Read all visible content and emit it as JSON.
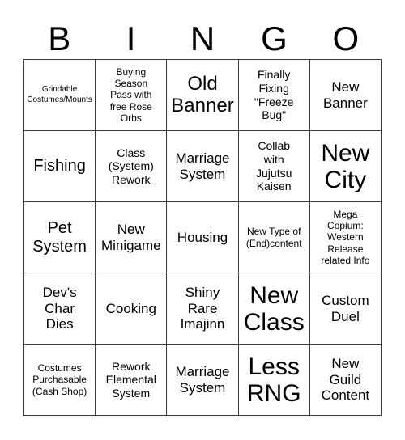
{
  "card": {
    "header_letters": [
      "B",
      "I",
      "N",
      "G",
      "O"
    ],
    "colors": {
      "background": "#ffffff",
      "text": "#000000",
      "grid_line": "#3a3a3a"
    },
    "rows": [
      [
        {
          "text": "Grindable\nCostumes/Mounts",
          "size": "xxs"
        },
        {
          "text": "Buying\nSeason\nPass with\nfree Rose\nOrbs",
          "size": "xs"
        },
        {
          "text": "Old\nBanner",
          "size": "xl"
        },
        {
          "text": "Finally\nFixing\n\"Freeze\nBug\"",
          "size": "s"
        },
        {
          "text": "New\nBanner",
          "size": "m"
        }
      ],
      [
        {
          "text": "Fishing",
          "size": "l"
        },
        {
          "text": "Class\n(System)\nRework",
          "size": "s"
        },
        {
          "text": "Marriage\nSystem",
          "size": "m"
        },
        {
          "text": "Collab\nwith\nJujutsu\nKaisen",
          "size": "s"
        },
        {
          "text": "New\nCity",
          "size": "xxl"
        }
      ],
      [
        {
          "text": "Pet\nSystem",
          "size": "l"
        },
        {
          "text": "New\nMinigame",
          "size": "m"
        },
        {
          "text": "Housing",
          "size": "m"
        },
        {
          "text": "New Type of\n(End)content",
          "size": "xs"
        },
        {
          "text": "Mega\nCopium:\nWestern\nRelease\nrelated Info",
          "size": "xs"
        }
      ],
      [
        {
          "text": "Dev's\nChar\nDies",
          "size": "m"
        },
        {
          "text": "Cooking",
          "size": "m"
        },
        {
          "text": "Shiny\nRare\nImajinn",
          "size": "m"
        },
        {
          "text": "New\nClass",
          "size": "xxl"
        },
        {
          "text": "Custom\nDuel",
          "size": "m"
        }
      ],
      [
        {
          "text": "Costumes\nPurchasable\n(Cash Shop)",
          "size": "xs"
        },
        {
          "text": "Rework\nElemental\nSystem",
          "size": "s"
        },
        {
          "text": "Marriage\nSystem",
          "size": "m"
        },
        {
          "text": "Less\nRNG",
          "size": "xxl"
        },
        {
          "text": "New\nGuild\nContent",
          "size": "m"
        }
      ]
    ]
  }
}
